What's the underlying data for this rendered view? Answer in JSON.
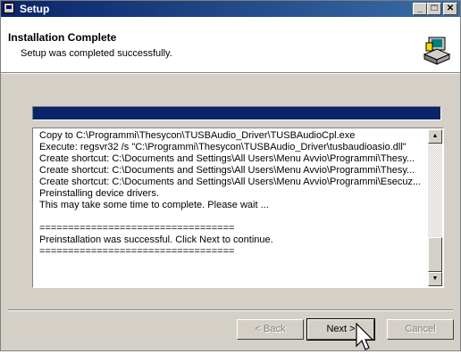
{
  "window": {
    "title": "Setup",
    "icon": "setup-icon"
  },
  "header": {
    "title": "Installation Complete",
    "subtitle": "Setup was completed successfully.",
    "icon": "installer-computer-icon"
  },
  "progress": {
    "value": 1.0,
    "color": "#0a246a"
  },
  "log": {
    "lines": [
      "Copy to C:\\Programmi\\Thesycon\\TUSBAudio_Driver\\TUSBAudioCpl.exe",
      "Execute: regsvr32 /s \"C:\\Programmi\\Thesycon\\TUSBAudio_Driver\\tusbaudioasio.dll\"",
      "Create shortcut: C:\\Documents and Settings\\All Users\\Menu Avvio\\Programmi\\Thesy...",
      "Create shortcut: C:\\Documents and Settings\\All Users\\Menu Avvio\\Programmi\\Thesy...",
      "Create shortcut: C:\\Documents and Settings\\All Users\\Menu Avvio\\Programmi\\Esecuz...",
      "Preinstalling device drivers.",
      "This may take some time to complete. Please wait ...",
      "",
      "==================================",
      "Preinstallation was successful. Click Next to continue.",
      "=================================="
    ]
  },
  "buttons": {
    "back": "< Back",
    "next": "Next >",
    "cancel": "Cancel"
  },
  "colors": {
    "titlebar": "#0a246a",
    "face": "#d4d0c8"
  }
}
